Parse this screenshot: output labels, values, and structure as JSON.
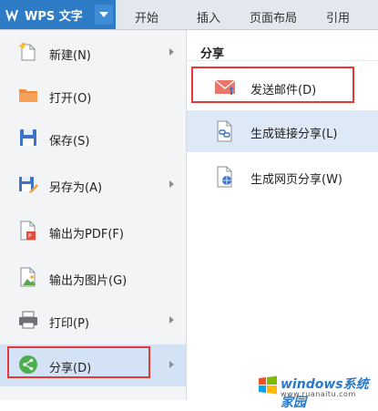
{
  "app": {
    "name": "WPS 文字"
  },
  "tabs": [
    "开始",
    "插入",
    "页面布局",
    "引用"
  ],
  "left_menu": {
    "items": [
      {
        "label": "新建(N)",
        "icon": "new-doc-icon",
        "has_submenu": true
      },
      {
        "label": "打开(O)",
        "icon": "folder-icon",
        "has_submenu": false
      },
      {
        "label": "保存(S)",
        "icon": "save-icon",
        "has_submenu": false
      },
      {
        "label": "另存为(A)",
        "icon": "save-as-icon",
        "has_submenu": true
      },
      {
        "label": "输出为PDF(F)",
        "icon": "pdf-icon",
        "has_submenu": false
      },
      {
        "label": "输出为图片(G)",
        "icon": "image-export-icon",
        "has_submenu": false
      },
      {
        "label": "打印(P)",
        "icon": "printer-icon",
        "has_submenu": true
      },
      {
        "label": "分享(D)",
        "icon": "share-icon",
        "has_submenu": true,
        "selected": true
      }
    ]
  },
  "right_panel": {
    "title": "分享",
    "items": [
      {
        "label": "发送邮件(D)",
        "icon": "email-icon",
        "highlighted": true
      },
      {
        "label": "生成链接分享(L)",
        "icon": "link-share-icon",
        "selected": true
      },
      {
        "label": "生成网页分享(W)",
        "icon": "web-share-icon"
      }
    ]
  },
  "watermark": {
    "text": "windows系统家园",
    "url": "www.ruanaitu.com"
  },
  "colors": {
    "accent": "#2e7bc6",
    "highlight_border": "#e53935",
    "selected_bg": "#d3e2f5"
  }
}
